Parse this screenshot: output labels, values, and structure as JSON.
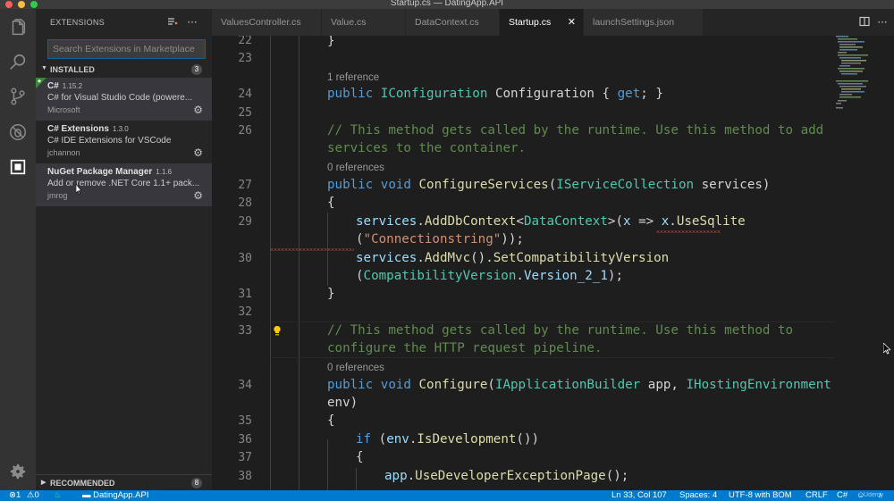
{
  "window": {
    "title": "Startup.cs — DatingApp.API",
    "colors": {
      "close": "#fc605c",
      "minimize": "#fdbc40",
      "zoom": "#34c84a"
    }
  },
  "activity_bar": {
    "icons": [
      "files-icon",
      "search-icon",
      "source-control-icon",
      "debug-icon",
      "extensions-icon",
      "settings-gear-icon"
    ]
  },
  "sidebar": {
    "title": "EXTENSIONS",
    "search_placeholder": "Search Extensions in Marketplace",
    "installed": {
      "label": "INSTALLED",
      "count": "3",
      "items": [
        {
          "name": "C#",
          "version": "1.15.2",
          "description": "C# for Visual Studio Code (powere...",
          "author": "Microsoft"
        },
        {
          "name": "C# Extensions",
          "version": "1.3.0",
          "description": "C# IDE Extensions for VSCode",
          "author": "jchannon"
        },
        {
          "name": "NuGet Package Manager",
          "version": "1.1.6",
          "description": "Add or remove .NET Core 1.1+ pack...",
          "author": "jmrog"
        }
      ]
    },
    "recommended": {
      "label": "RECOMMENDED",
      "count": "8"
    }
  },
  "tabs": [
    {
      "label": "ValuesController.cs"
    },
    {
      "label": "Value.cs"
    },
    {
      "label": "DataContext.cs"
    },
    {
      "label": "Startup.cs",
      "close": "✕"
    },
    {
      "label": "launchSettings.json"
    }
  ],
  "editor": {
    "lines": [
      {
        "num": "22",
        "code": "}"
      },
      {
        "num": "23",
        "code": ""
      },
      {
        "lens": "1 reference"
      },
      {
        "num": "24",
        "code": "public IConfiguration Configuration { get; }"
      },
      {
        "num": "25",
        "code": ""
      },
      {
        "num": "26",
        "code": "// This method gets called by the runtime. Use this method to add"
      },
      {
        "code": "services to the container."
      },
      {
        "lens": "0 references"
      },
      {
        "num": "27",
        "code": "public void ConfigureServices(IServiceCollection services)"
      },
      {
        "num": "28",
        "code": "{"
      },
      {
        "num": "29",
        "code": "services.AddDbContext<DataContext>(x => x.UseSqlite"
      },
      {
        "code": "(\"Connectionstring\"));"
      },
      {
        "num": "30",
        "code": "services.AddMvc().SetCompatibilityVersion"
      },
      {
        "code": "(CompatibilityVersion.Version_2_1);"
      },
      {
        "num": "31",
        "code": "}"
      },
      {
        "num": "32",
        "code": ""
      },
      {
        "num": "33",
        "code": "// This method gets called by the runtime. Use this method to"
      },
      {
        "code": "configure the HTTP request pipeline."
      },
      {
        "lens": "0 references"
      },
      {
        "num": "34",
        "code": "public void Configure(IApplicationBuilder app, IHostingEnvironment"
      },
      {
        "code": "env)"
      },
      {
        "num": "35",
        "code": "{"
      },
      {
        "num": "36",
        "code": "if (env.IsDevelopment())"
      },
      {
        "num": "37",
        "code": "{"
      },
      {
        "num": "38",
        "code": "app.UseDeveloperExceptionPage();"
      }
    ]
  },
  "status_bar": {
    "errors": "1",
    "warnings": "0",
    "folder": "DatingApp.API",
    "position": "Ln 33, Col 107",
    "spaces": "Spaces: 4",
    "encoding": "UTF-8 with BOM",
    "eol": "CRLF",
    "language": "C#",
    "watermark": "Udemy"
  }
}
